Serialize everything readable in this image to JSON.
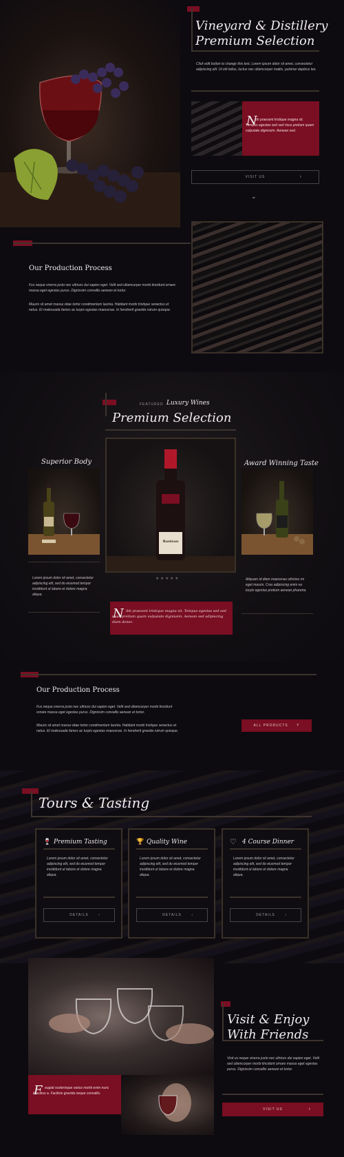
{
  "hero": {
    "title_line1": "Vineyard & Distillery",
    "title_line2": "Premium Selection",
    "intro": "Click edit button to change this text. Lorem ipsum dolor sit amet, consectetur adipiscing elit. Ut elit tellus, luctus nec ullamcorper mattis, pulvinar dapibus leo.",
    "quote_initial": "N",
    "quote_text": "ibh praesent tristique magna sit. Tempus egestas sed sed risus pretium quam vulputate dignissim. Aenean sed.",
    "visit_label": "VISIT US",
    "chevron": "›",
    "scroll_icon": "⌄"
  },
  "production1": {
    "heading": "Our Production Process",
    "p1": "Fus neque viverra justo nec ultrices dui sapien eget. Velit sed ullamcorper morbi tincidunt ornare massa eget egestas purus. Dignissim convallis aenean et tortor.",
    "p2": "Mauris sit amet massa vitae tortor condimentum lacinia. Habitant morbi tristique senectus et netus. Et malesuada fames ac turpis egestas maecenas. In hendrerit gravida rutrum quisque."
  },
  "featured": {
    "kicker": "FEATURED",
    "kicker_script": "Luxury Wines",
    "title": "Premium Selection",
    "left_title": "Superior Body",
    "left_text": "Lorem ipsum dolor sit amet, consectetur adipiscing elit, sed do eiusmod tempor incididunt ut labore et dolore magna aliqua.",
    "right_title": "Award Winning Taste",
    "right_text": "Aliquam id diam maecenas ultricies mi eget mauris. Cras adipiscing enim eu turpis egestas pretium aenean pharetra.",
    "stars": "★ ★ ★ ★ ★",
    "bottle_label": "Rasteau",
    "quote_initial": "N",
    "quote_text": "ibh praesent tristique magna sit. Tempus egestas sed sed risus pretium quam vulputate dignissim. Aenean sed adipiscing diam donec."
  },
  "production2": {
    "heading": "Our Production Process",
    "p1": "Fus neque viverra justo nec ultrices dui sapien eget. Velit sed ullamcorper morbi tincidunt ornare massa eget egestas purus. Dignissim convallis aenean et tortor.",
    "p2": "Mauris sit amet massa vitae tortor condimentum lacinia. Habitant morbi tristique senectus et netus. Et malesuada fames ac turpis egestas maecenas. In hendrerit gravida rutrum quisque.",
    "button": "ALL PRODUCTS",
    "button_icon": "Y"
  },
  "tours": {
    "title": "Tours & Tasting",
    "cards": [
      {
        "icon": "wine-glass-icon",
        "glyph": "🍷",
        "title": "Premium Tasting",
        "text": "Lorem ipsum dolor sit amet, consectetur adipiscing elit, sed do eiusmod tempor incididunt ut labore et dolore magna aliqua.",
        "button": "DETAILS"
      },
      {
        "icon": "trophy-icon",
        "glyph": "🏆",
        "title": "Quality Wine",
        "text": "Lorem ipsum dolor sit amet, consectetur adipiscing elit, sed do eiusmod tempor incididunt ut labore et dolore magna aliqua.",
        "button": "DETAILS"
      },
      {
        "icon": "heart-icon",
        "glyph": "♡",
        "title": "4 Course Dinner",
        "text": "Lorem ipsum dolor sit amet, consectetur adipiscing elit, sed do eiusmod tempor incididunt ut labore et dolore magna aliqua.",
        "button": "DETAILS"
      }
    ]
  },
  "visit": {
    "title_line1": "Visit & Enjoy",
    "title_line2": "With Friends",
    "text": "Visit us neque viverra justo nec ultrices dui sapien eget. Velit sed ullamcorper morbi tincidunt ornare massa eget egestas purus. Dignissim convallis aenean et tortor.",
    "quote_initial": "F",
    "quote_text": "eugiat scelerisque varius morbi enim nunc faucibus a. Facilisis gravida neque convallis.",
    "button": "VISIT US"
  },
  "colors": {
    "accent": "#7a0e22",
    "background": "#0d0b10",
    "gold": "#3c342e"
  }
}
